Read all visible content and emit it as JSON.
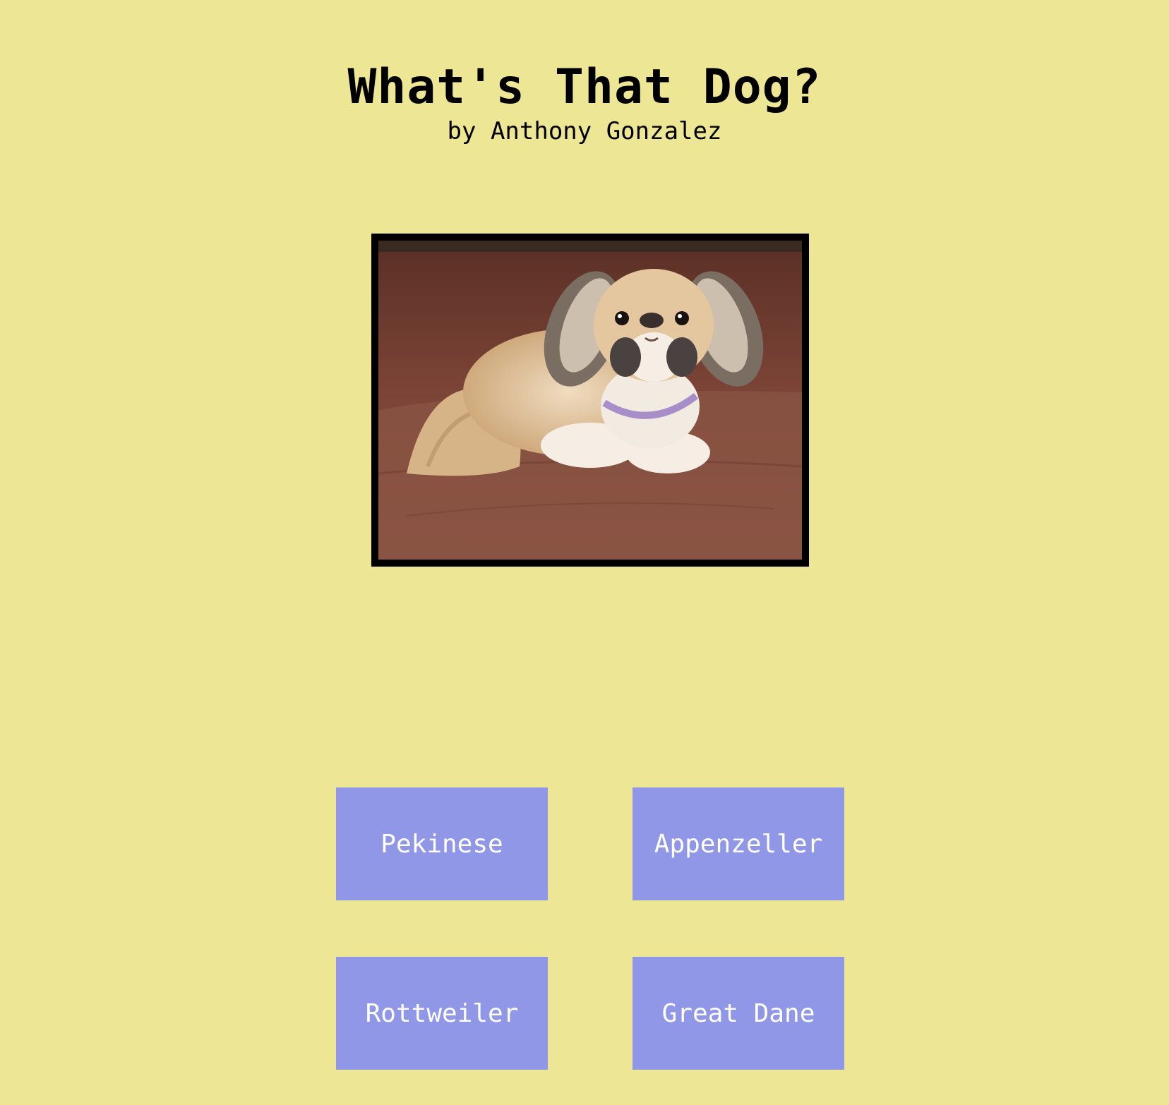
{
  "header": {
    "title": "What's That Dog?",
    "byline": "by Anthony Gonzalez"
  },
  "photo": {
    "subject": "dog-photo",
    "frame_color": "#000000"
  },
  "choices": [
    {
      "label": "Pekinese"
    },
    {
      "label": "Appenzeller"
    },
    {
      "label": "Rottweiler"
    },
    {
      "label": "Great Dane"
    }
  ],
  "colors": {
    "background": "#ede695",
    "button": "#8f97e6",
    "button_text": "#ffffff"
  }
}
